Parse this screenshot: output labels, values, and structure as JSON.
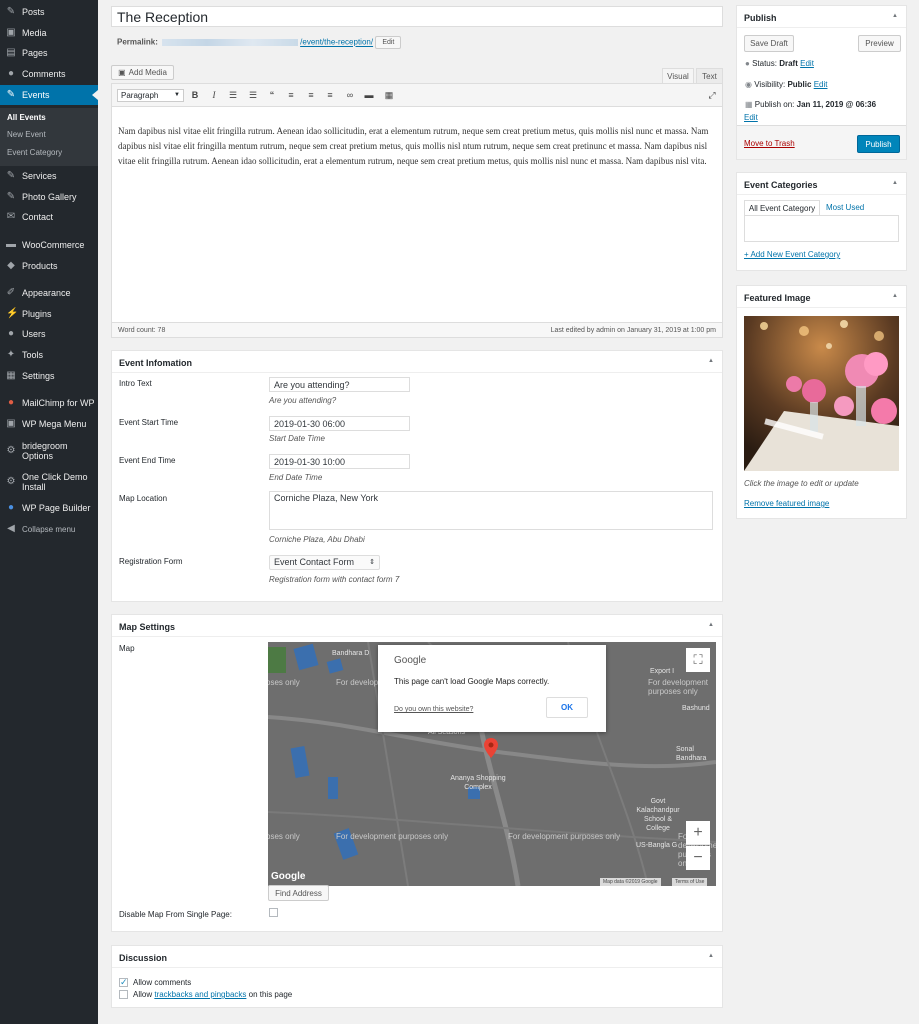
{
  "sidebar": {
    "items": [
      {
        "label": "Posts",
        "icon": "pushpin-icon"
      },
      {
        "label": "Media",
        "icon": "media-icon"
      },
      {
        "label": "Pages",
        "icon": "pages-icon"
      },
      {
        "label": "Comments",
        "icon": "comments-icon"
      },
      {
        "label": "Events",
        "icon": "events-icon"
      },
      {
        "label": "Services",
        "icon": "pushpin-icon"
      },
      {
        "label": "Photo Gallery",
        "icon": "pushpin-icon"
      },
      {
        "label": "Contact",
        "icon": "mail-icon"
      },
      {
        "label": "WooCommerce",
        "icon": "woo-icon"
      },
      {
        "label": "Products",
        "icon": "products-icon"
      },
      {
        "label": "Appearance",
        "icon": "brush-icon"
      },
      {
        "label": "Plugins",
        "icon": "plugin-icon"
      },
      {
        "label": "Users",
        "icon": "users-icon"
      },
      {
        "label": "Tools",
        "icon": "wrench-icon"
      },
      {
        "label": "Settings",
        "icon": "settings-icon"
      },
      {
        "label": "MailChimp for WP",
        "icon": "mailchimp-icon"
      },
      {
        "label": "WP Mega Menu",
        "icon": "menu-icon"
      },
      {
        "label": "bridegroom Options",
        "icon": "gear-icon"
      },
      {
        "label": "One Click Demo Install",
        "icon": "gear-icon"
      },
      {
        "label": "WP Page Builder",
        "icon": "builder-icon"
      },
      {
        "label": "Collapse menu",
        "icon": "collapse-icon"
      }
    ],
    "submenu": [
      "All Events",
      "New Event",
      "Event Category"
    ]
  },
  "post": {
    "title": "The Reception",
    "permalink_label": "Permalink:",
    "permalink_slug": "/event/the-reception/",
    "permalink_edit": "Edit"
  },
  "editor": {
    "add_media": "Add Media",
    "tab_visual": "Visual",
    "tab_text": "Text",
    "format": "Paragraph",
    "content": "Nam dapibus nisl vitae elit fringilla rutrum. Aenean idao sollicitudin, erat a elementum rutrum, neque sem creat pretium metus, quis mollis nisl nunc et massa. Nam dapibus nisl vitae elit fringilla mentum rutrum, neque sem creat pretium metus, quis mollis nisl ntum rutrum, neque sem creat pretinunc et massa. Nam dapibus nisl vitae elit fringilla rutrum. Aenean idao sollicitudin, erat a elementum rutrum, neque sem creat pretium metus, quis mollis nisl nunc et massa. Nam dapibus nisl vita.",
    "word_count": "Word count: 78",
    "last_edited": "Last edited by admin on January 31, 2019 at 1:00 pm"
  },
  "event_info": {
    "title": "Event Infomation",
    "intro_label": "Intro Text",
    "intro_value": "Are you attending?",
    "intro_desc": "Are you attending?",
    "start_label": "Event Start Time",
    "start_value": "2019-01-30 06:00",
    "start_desc": "Start Date Time",
    "end_label": "Event End Time",
    "end_value": "2019-01-30 10:00",
    "end_desc": "End Date Time",
    "map_label": "Map Location",
    "map_value": "Corniche Plaza, New York",
    "map_desc": "Corniche Plaza, Abu Dhabi",
    "reg_label": "Registration Form",
    "reg_value": "Event Contact Form",
    "reg_desc": "Registration form with contact form 7"
  },
  "map_settings": {
    "title": "Map Settings",
    "map_label": "Map",
    "dialog_brand": "Google",
    "dialog_msg": "This page can't load Google Maps correctly.",
    "dialog_link": "Do you own this website?",
    "dialog_ok": "OK",
    "watermark": "For development purposes only",
    "watermark_short": "oses only",
    "place_1": "Bandhara D",
    "place_2": "Export I",
    "place_3": "All Seasons",
    "place_4": "Ananya Shopping Complex",
    "place_5": "Govt Kalachandpur School & College",
    "place_6": "US-Bangla G",
    "place_7": "Bashund",
    "place_8": "Sonal Bandhara",
    "logo": "Google",
    "map_data": "Map data ©2019 Google",
    "terms": "Terms of Use",
    "find_address": "Find Address",
    "disable_label": "Disable Map From Single Page:"
  },
  "discussion": {
    "title": "Discussion",
    "allow_comments": "Allow comments",
    "allow_pre": "Allow ",
    "allow_link": "trackbacks and pingbacks",
    "allow_post": " on this page"
  },
  "publish": {
    "title": "Publish",
    "save_draft": "Save Draft",
    "preview": "Preview",
    "status_label": "Status:",
    "status_value": "Draft",
    "visibility_label": "Visibility:",
    "visibility_value": "Public",
    "publish_on_label": "Publish on:",
    "publish_on_value": "Jan 11, 2019 @ 06:36",
    "edit": "Edit",
    "trash": "Move to Trash",
    "publish_btn": "Publish"
  },
  "categories": {
    "title": "Event Categories",
    "tab_all": "All Event Category",
    "tab_used": "Most Used",
    "add_new": "+ Add New Event Category"
  },
  "featured": {
    "title": "Featured Image",
    "hint": "Click the image to edit or update",
    "remove": "Remove featured image"
  },
  "colors": {
    "accent": "#0073aa",
    "sidebar": "#23282d",
    "publish": "#0085ba",
    "trash": "#a00"
  }
}
